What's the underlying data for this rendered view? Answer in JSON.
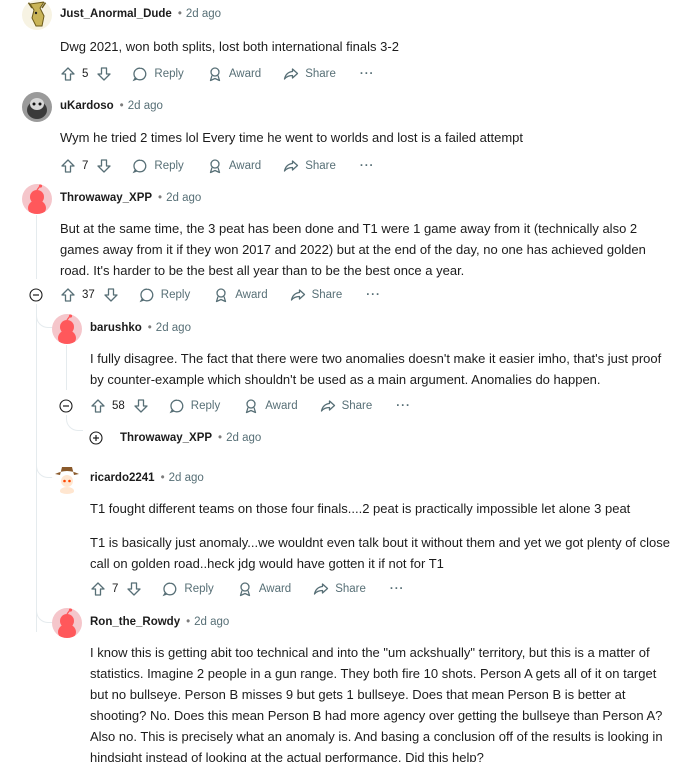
{
  "comments": [
    {
      "author": "Just_Anormal_Dude",
      "time": "2d ago",
      "paragraphs": [
        "Dwg 2021, won both splits, lost both international finals 3-2"
      ],
      "score": "5",
      "avatar": "goat-avatar"
    },
    {
      "author": "uKardoso",
      "time": "2d ago",
      "paragraphs": [
        "Wym he tried 2 times lol Every time he went to worlds and lost is a failed attempt"
      ],
      "score": "7",
      "avatar": "animal-photo-avatar"
    },
    {
      "author": "Throwaway_XPP",
      "time": "2d ago",
      "paragraphs": [
        "But at the same time, the 3 peat has been done and T1 were 1 game away from it (technically also 2 games away from it if they won 2017 and 2022) but at the end of the day, no one has achieved golden road. It's harder to be the best all year than to be the best once a year."
      ],
      "score": "37",
      "avatar": "default-snoo-avatar"
    },
    {
      "author": "barushko",
      "time": "2d ago",
      "paragraphs": [
        "I fully disagree. The fact that there were two anomalies doesn't make it easier imho, that's just proof by counter-example which shouldn't be used as a main argument. Anomalies do happen."
      ],
      "score": "58",
      "avatar": "default-snoo-avatar"
    },
    {
      "author": "Throwaway_XPP",
      "time": "2d ago",
      "collapsed": true
    },
    {
      "author": "ricardo2241",
      "time": "2d ago",
      "paragraphs": [
        "T1 fought different teams on those four finals....2 peat is practically impossible let alone 3 peat",
        "T1 is basically just anomaly...we wouldnt even talk bout it without them and yet we got plenty of close call on golden road..heck jdg would have gotten it if not for T1"
      ],
      "score": "7",
      "avatar": "cowboy-snoo-avatar"
    },
    {
      "author": "Ron_the_Rowdy",
      "time": "2d ago",
      "paragraphs": [
        "I know this is getting abit too technical and into the \"um ackshually\" territory, but this is a matter of statistics. Imagine 2 people in a gun range. They both fire 10 shots. Person A gets all of it on target but no bullseye. Person B misses 9 but gets 1 bullseye. Does that mean Person B is better at shooting? No. Does this mean Person B had more agency over getting the bullseye than Person A? Also no. This is precisely what an anomaly is. And basing a conclusion off of the results is looking in hindsight instead of looking at the actual performance. Did this help?"
      ],
      "avatar": "default-snoo-avatar"
    }
  ],
  "labels": {
    "reply": "Reply",
    "award": "Award",
    "share": "Share",
    "more": "···"
  },
  "colors": {
    "snoo_pink": "#ff585b",
    "snoo_bg": "#f5c6cb",
    "meta_gray": "#576f76",
    "thread_line": "#e5ebee"
  }
}
